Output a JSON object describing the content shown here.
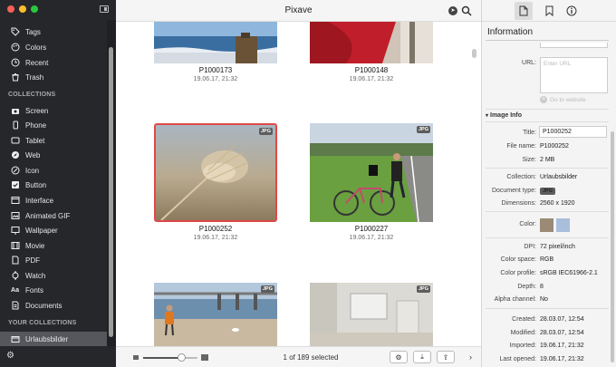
{
  "app": {
    "title": "Pixave"
  },
  "sidebar": {
    "items_top": [
      {
        "label": "Tags",
        "icon": "tag-icon"
      },
      {
        "label": "Colors",
        "icon": "palette-icon"
      },
      {
        "label": "Recent",
        "icon": "clock-icon"
      },
      {
        "label": "Trash",
        "icon": "trash-icon"
      }
    ],
    "collections_header": "COLLECTIONS",
    "collections": [
      {
        "label": "Screen",
        "icon": "camera-icon"
      },
      {
        "label": "Phone",
        "icon": "phone-icon"
      },
      {
        "label": "Tablet",
        "icon": "tablet-icon"
      },
      {
        "label": "Web",
        "icon": "compass-icon"
      },
      {
        "label": "Icon",
        "icon": "icon-glyph-icon"
      },
      {
        "label": "Button",
        "icon": "checkbox-icon"
      },
      {
        "label": "Interface",
        "icon": "interface-icon"
      },
      {
        "label": "Animated GIF",
        "icon": "gif-icon"
      },
      {
        "label": "Wallpaper",
        "icon": "image-icon"
      },
      {
        "label": "Movie",
        "icon": "film-icon"
      },
      {
        "label": "PDF",
        "icon": "pdf-icon"
      },
      {
        "label": "Watch",
        "icon": "watch-icon"
      },
      {
        "label": "Fonts",
        "icon": "font-icon"
      },
      {
        "label": "Documents",
        "icon": "document-icon"
      }
    ],
    "your_collections_header": "YOUR COLLECTIONS",
    "your_collections": [
      {
        "label": "Urlaubsbilder",
        "icon": "folder-icon",
        "selected": true
      }
    ]
  },
  "grid": {
    "tiles": [
      {
        "name": "P1000173",
        "date": "19.06.17, 21:32",
        "badge": "",
        "selected": false
      },
      {
        "name": "P1000148",
        "date": "19.06.17, 21:32",
        "badge": "",
        "selected": false
      },
      {
        "name": "P1000252",
        "date": "19.06.17, 21:32",
        "badge": "JPG",
        "selected": true
      },
      {
        "name": "P1000227",
        "date": "19.06.17, 21:32",
        "badge": "JPG",
        "selected": false
      },
      {
        "name": "",
        "date": "",
        "badge": "JPG",
        "selected": false
      },
      {
        "name": "",
        "date": "",
        "badge": "JPG",
        "selected": false
      }
    ]
  },
  "bottombar": {
    "status": "1 of 189 selected",
    "zoom_fraction": 0.7
  },
  "info": {
    "title": "Information",
    "url_label": "URL:",
    "url_placeholder": "Enter URL",
    "go_to_website": "Go to website",
    "section_image_info": "Image Info",
    "title_label": "Title:",
    "title_value": "P1000252",
    "file_name_label": "File name:",
    "file_name_value": "P1000252",
    "size_label": "Size:",
    "size_value": "2 MB",
    "collection_label": "Collection:",
    "collection_value": "Urlaubsbilder",
    "doctype_label": "Document type:",
    "doctype_value": "JPG",
    "dimensions_label": "Dimensions:",
    "dimensions_value": "2560 x 1920",
    "color_label": "Color:",
    "colors": [
      "#9a8a76",
      "#a9bedb"
    ],
    "dpi_label": "DPI:",
    "dpi_value": "72 pixel/inch",
    "colorspace_label": "Color space:",
    "colorspace_value": "RGB",
    "colorprofile_label": "Color profile:",
    "colorprofile_value": "sRGB IEC61966-2.1",
    "depth_label": "Depth:",
    "depth_value": "8",
    "alpha_label": "Alpha channel:",
    "alpha_value": "No",
    "created_label": "Created:",
    "created_value": "28.03.07, 12:54",
    "modified_label": "Modified:",
    "modified_value": "28.03.07, 12:54",
    "imported_label": "Imported:",
    "imported_value": "19.06.17, 21:32",
    "lastopened_label": "Last opened:",
    "lastopened_value": "19.06.17, 21:32"
  }
}
